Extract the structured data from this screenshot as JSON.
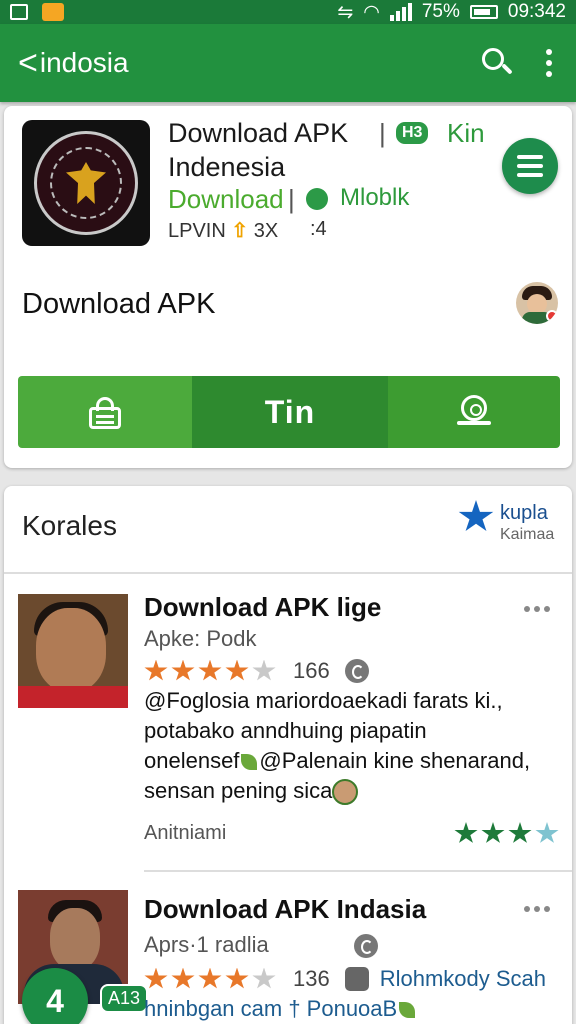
{
  "status_bar": {
    "battery": "75%",
    "time": "09:342"
  },
  "app_bar": {
    "back_glyph": "<",
    "title": "indosia"
  },
  "app_card": {
    "title": "Download APK",
    "separator": "|",
    "pill": "H3",
    "kin": "Kin",
    "subtitle": "Indenesia",
    "download_label": "Download",
    "separator2": "|",
    "mobile_label": "Mloblk",
    "meta_left": "LPVIN",
    "meta_mid": "3X",
    "meta_right": ":4",
    "section_title": "Download APK",
    "action_middle_label": "Tin"
  },
  "reviews": {
    "section_title": "Korales",
    "badge_title": "kupla",
    "badge_sub": "Kaimaa",
    "items": [
      {
        "title": "Download APK lige",
        "subtitle": "Apke: Podk",
        "rating": 4,
        "count": "166",
        "body_line1": "Foglosia mariordoaekadi farats ki.,",
        "body_line2": "potabako anndhuing piapatin",
        "body_line3a": "onelensef",
        "body_line3b": "@Palenain kine shenarand,",
        "body_line4": "sensan pening sica",
        "footer": "Anitniami",
        "footer_rating": 3
      },
      {
        "title": "Download APK Indasia",
        "subtitle": "Aprs·1 radlia",
        "rating": 4,
        "count": "136",
        "link": "Rlohmkody Scah",
        "body_line1": "hninbgan cam † PonuoaB"
      }
    ]
  },
  "fab_count": "4",
  "badge_a13": "A13",
  "colors": {
    "primary": "#22913f",
    "status_bar": "#1b7a39",
    "rating_star": "#e8782a",
    "link": "#1d5c8f"
  }
}
